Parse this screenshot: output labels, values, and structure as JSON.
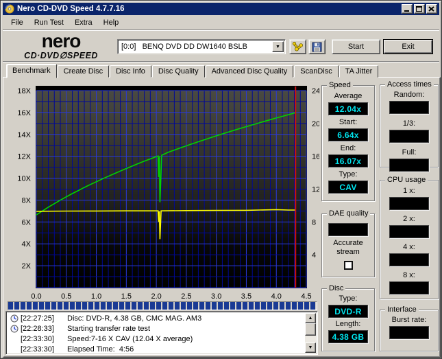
{
  "window": {
    "title": "Nero CD-DVD Speed 4.7.7.16"
  },
  "titlebar_buttons": {
    "minimize": "minimize",
    "maximize": "maximize",
    "close": "close"
  },
  "menu": {
    "items": [
      "File",
      "Run Test",
      "Extra",
      "Help"
    ]
  },
  "toolbar": {
    "logo_line1": "nero",
    "logo_line2": "CD·DVD∅SPEED",
    "drive_select": "[0:0]   BENQ DVD DD DW1640 BSLB",
    "start_label": "Start",
    "exit_label": "Exit"
  },
  "tabs": [
    {
      "label": "Benchmark",
      "active": true
    },
    {
      "label": "Create Disc",
      "active": false
    },
    {
      "label": "Disc Info",
      "active": false
    },
    {
      "label": "Disc Quality",
      "active": false
    },
    {
      "label": "Advanced Disc Quality",
      "active": false
    },
    {
      "label": "ScanDisc",
      "active": false
    },
    {
      "label": "TA Jitter",
      "active": false
    }
  ],
  "chart_data": {
    "type": "line",
    "title": "",
    "xlabel": "",
    "ylabel": "",
    "grid": true,
    "legend": "none",
    "x_axis": {
      "min": 0,
      "max": 4.5,
      "minor_step": 0.1,
      "major_step": 0.5,
      "tick_values": [
        0,
        0.5,
        1,
        1.5,
        2,
        2.5,
        3,
        3.5,
        4,
        4.5
      ],
      "tick_labels": [
        "0.0",
        "0.5",
        "1.0",
        "1.5",
        "2.0",
        "2.5",
        "3.0",
        "3.5",
        "4.0",
        "4.5"
      ]
    },
    "y_left": {
      "min": 0,
      "max": 18,
      "minor_step": 1,
      "major_step": 2,
      "tick_values": [
        2,
        4,
        6,
        8,
        10,
        12,
        14,
        16,
        18
      ],
      "tick_labels": [
        "2X",
        "4X",
        "6X",
        "8X",
        "10X",
        "12X",
        "14X",
        "16X",
        "18X"
      ]
    },
    "y_right": {
      "min": 0,
      "max": 24,
      "tick_values": [
        4,
        8,
        12,
        16,
        20,
        24
      ],
      "tick_labels": [
        "4",
        "8",
        "12",
        "16",
        "20",
        "24"
      ]
    },
    "series": [
      {
        "name": "read-speed",
        "axis": "left",
        "color": "#00d400",
        "points": [
          [
            0,
            6.64
          ],
          [
            0.1,
            7.0
          ],
          [
            0.2,
            7.35
          ],
          [
            0.3,
            7.67
          ],
          [
            0.4,
            7.99
          ],
          [
            0.5,
            8.3
          ],
          [
            0.6,
            8.59
          ],
          [
            0.7,
            8.87
          ],
          [
            0.8,
            9.15
          ],
          [
            0.9,
            9.42
          ],
          [
            1.0,
            9.67
          ],
          [
            1.1,
            9.93
          ],
          [
            1.2,
            10.17
          ],
          [
            1.3,
            10.41
          ],
          [
            1.4,
            10.65
          ],
          [
            1.5,
            10.88
          ],
          [
            1.6,
            11.11
          ],
          [
            1.7,
            11.33
          ],
          [
            1.8,
            11.55
          ],
          [
            1.9,
            11.76
          ],
          [
            2.0,
            11.97
          ],
          [
            2.03,
            12.03
          ],
          [
            2.04,
            10.1
          ],
          [
            2.05,
            12.0
          ],
          [
            2.06,
            7.8
          ],
          [
            2.09,
            12.1
          ],
          [
            2.2,
            12.37
          ],
          [
            2.3,
            12.57
          ],
          [
            2.4,
            12.76
          ],
          [
            2.5,
            12.96
          ],
          [
            2.6,
            13.14
          ],
          [
            2.7,
            13.33
          ],
          [
            2.8,
            13.51
          ],
          [
            2.9,
            13.69
          ],
          [
            3.0,
            13.87
          ],
          [
            3.1,
            14.04
          ],
          [
            3.2,
            14.21
          ],
          [
            3.3,
            14.38
          ],
          [
            3.4,
            14.55
          ],
          [
            3.5,
            14.71
          ],
          [
            3.6,
            14.87
          ],
          [
            3.7,
            15.03
          ],
          [
            3.8,
            15.19
          ],
          [
            3.9,
            15.35
          ],
          [
            4.0,
            15.5
          ],
          [
            4.1,
            15.65
          ],
          [
            4.2,
            15.8
          ],
          [
            4.3,
            15.95
          ],
          [
            4.32,
            16.07
          ]
        ]
      },
      {
        "name": "rotation-speed",
        "axis": "right",
        "color": "#ffff00",
        "points": [
          [
            0,
            9.3
          ],
          [
            0.5,
            9.32
          ],
          [
            1.0,
            9.33
          ],
          [
            1.5,
            9.35
          ],
          [
            2.0,
            9.35
          ],
          [
            2.03,
            9.35
          ],
          [
            2.04,
            8.0
          ],
          [
            2.05,
            9.3
          ],
          [
            2.06,
            5.9
          ],
          [
            2.08,
            9.35
          ],
          [
            2.5,
            9.38
          ],
          [
            3.0,
            9.4
          ],
          [
            3.5,
            9.42
          ],
          [
            4.0,
            9.5
          ],
          [
            4.2,
            9.45
          ],
          [
            4.32,
            9.45
          ]
        ]
      }
    ],
    "end_marker": {
      "x": 4.32,
      "color": "#cc1111"
    }
  },
  "panels": {
    "speed": {
      "title": "Speed",
      "fields": [
        {
          "label": "Average",
          "value": "12.04x"
        },
        {
          "label": "Start:",
          "value": "6.64x"
        },
        {
          "label": "End:",
          "value": "16.07x"
        },
        {
          "label": "Type:",
          "value": "CAV"
        }
      ]
    },
    "access_times": {
      "title": "Access times",
      "fields": [
        {
          "label": "Random:",
          "value": ""
        },
        {
          "label": "1/3:",
          "value": ""
        },
        {
          "label": "Full:",
          "value": ""
        }
      ]
    },
    "cpu_usage": {
      "title": "CPU usage",
      "fields": [
        {
          "label": "1 x:",
          "value": ""
        },
        {
          "label": "2 x:",
          "value": ""
        },
        {
          "label": "4 x:",
          "value": ""
        },
        {
          "label": "8 x:",
          "value": ""
        }
      ]
    },
    "dae_quality": {
      "title": "DAE quality",
      "display_value": "",
      "checkbox_label": "Accurate stream",
      "checked": false
    },
    "disc": {
      "title": "Disc",
      "fields": [
        {
          "label": "Type:",
          "value": "DVD-R"
        },
        {
          "label": "Length:",
          "value": "4.38 GB"
        }
      ]
    },
    "interface": {
      "title": "Interface",
      "fields": [
        {
          "label": "Burst rate:",
          "value": ""
        }
      ]
    }
  },
  "progress": {
    "percent": 100
  },
  "log": {
    "entries": [
      {
        "icon": true,
        "time": "[22:27:25]",
        "text": "Disc: DVD-R, 4.38 GB, CMC MAG. AM3"
      },
      {
        "icon": true,
        "time": "[22:28:33]",
        "text": "Starting transfer rate test"
      },
      {
        "icon": false,
        "time": "[22:33:30]",
        "text": "Speed:7-16 X CAV (12.04 X average)"
      },
      {
        "icon": false,
        "time": "[22:33:30]",
        "text": "Elapsed Time:  4:56"
      }
    ]
  },
  "colors": {
    "titlebar": "#0a246a",
    "window_face": "#d4d0c8",
    "lcd_bg": "#000000",
    "lcd_text": "#00e6f0",
    "grid_minor": "#000896",
    "grid_major": "#2a3ade",
    "progress_segment": "#1a3a94"
  }
}
